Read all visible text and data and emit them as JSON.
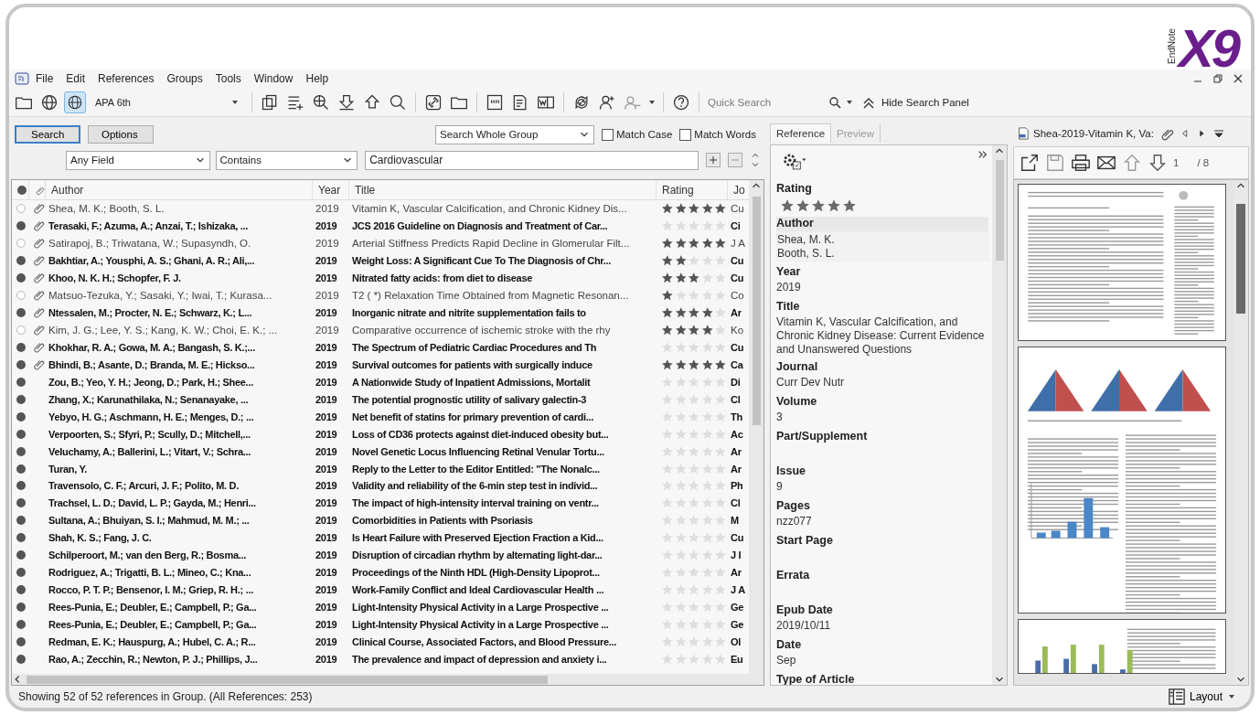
{
  "logo": {
    "product": "EndNote",
    "version": "X9"
  },
  "menu": [
    "File",
    "Edit",
    "References",
    "Groups",
    "Tools",
    "Window",
    "Help"
  ],
  "toolbar": {
    "style": "APA 6th",
    "quick_search": {
      "placeholder": "Quick Search"
    },
    "hide_search_panel": "Hide Search Panel"
  },
  "search_panel": {
    "search_button": "Search",
    "options_button": "Options",
    "scope": "Search Whole Group",
    "match_case": {
      "label": "Match Case",
      "checked": false
    },
    "match_words": {
      "label": "Match Words",
      "checked": false
    },
    "criteria": [
      {
        "field": "Any Field",
        "operator": "Contains",
        "value": "Cardiovascular"
      }
    ]
  },
  "table": {
    "columns": [
      "Author",
      "Year",
      "Title",
      "Rating",
      "Jo"
    ],
    "rows": [
      {
        "read": true,
        "attachment": true,
        "author": "Shea, M. K.; Booth, S. L.",
        "year": "2019",
        "title": "Vitamin K, Vascular Calcification, and Chronic Kidney Dis...",
        "stars": 5,
        "journal": "Cu"
      },
      {
        "read": false,
        "attachment": true,
        "author": "Terasaki, F.; Azuma, A.; Anzai, T.; Ishizaka, ...",
        "year": "2019",
        "title": "JCS 2016 Guideline on Diagnosis and Treatment of Car...",
        "stars": 0,
        "journal": "Ci"
      },
      {
        "read": true,
        "attachment": true,
        "author": "Satirapoj, B.; Triwatana, W.; Supasyndh, O.",
        "year": "2019",
        "title": "Arterial Stiffness Predicts Rapid Decline in Glomerular Filt...",
        "stars": 5,
        "journal": "J A"
      },
      {
        "read": false,
        "attachment": true,
        "author": "Bakhtiar, A.; Yousphi, A. S.; Ghani, A. R.; Ali,...",
        "year": "2019",
        "title": "Weight Loss: A Significant Cue To The Diagnosis of Chr...",
        "stars": 2,
        "journal": "Cu"
      },
      {
        "read": false,
        "attachment": true,
        "author": "Khoo, N. K. H.; Schopfer, F. J.",
        "year": "2019",
        "title": "Nitrated fatty acids: from diet to disease",
        "stars": 3,
        "journal": "Cu"
      },
      {
        "read": true,
        "attachment": true,
        "author": "Matsuo-Tezuka, Y.; Sasaki, Y.; Iwai, T.; Kurasa...",
        "year": "2019",
        "title": "T2 ( *) Relaxation Time Obtained from Magnetic Resonan...",
        "stars": 1,
        "journal": "Co"
      },
      {
        "read": false,
        "attachment": true,
        "author": "Ntessalen, M.; Procter, N. E.; Schwarz, K.; L...",
        "year": "2019",
        "title": "Inorganic nitrate and nitrite supplementation fails to",
        "stars": 4,
        "journal": "Ar"
      },
      {
        "read": true,
        "attachment": true,
        "author": "Kim, J. G.; Lee, Y. S.; Kang, K. W.; Choi, E. K.; ...",
        "year": "2019",
        "title": "Comparative occurrence of ischemic stroke with the rhy",
        "stars": 4,
        "journal": "Ko"
      },
      {
        "read": false,
        "attachment": true,
        "author": "Khokhar, R. A.; Gowa, M. A.; Bangash, S. K.;...",
        "year": "2019",
        "title": "The Spectrum of Pediatric Cardiac Procedures and Th",
        "stars": 0,
        "journal": "Cu"
      },
      {
        "read": false,
        "attachment": true,
        "author": "Bhindi, B.; Asante, D.; Branda, M. E.; Hickso...",
        "year": "2019",
        "title": "Survival outcomes for patients with surgically induce",
        "stars": 5,
        "journal": "Ca"
      },
      {
        "read": false,
        "attachment": false,
        "author": "Zou, B.; Yeo, Y. H.; Jeong, D.; Park, H.; Shee...",
        "year": "2019",
        "title": "A Nationwide Study of Inpatient Admissions, Mortalit",
        "stars": 0,
        "journal": "Di"
      },
      {
        "read": false,
        "attachment": false,
        "author": "Zhang, X.; Karunathilaka, N.; Senanayake, ...",
        "year": "2019",
        "title": "The potential prognostic utility of salivary galectin-3",
        "stars": 0,
        "journal": "Cl"
      },
      {
        "read": false,
        "attachment": false,
        "author": "Yebyo, H. G.; Aschmann, H. E.; Menges, D.; ...",
        "year": "2019",
        "title": "Net benefit of statins for primary prevention of cardi...",
        "stars": 0,
        "journal": "Th"
      },
      {
        "read": false,
        "attachment": false,
        "author": "Verpoorten, S.; Sfyri, P.; Scully, D.; Mitchell,...",
        "year": "2019",
        "title": "Loss of CD36 protects against diet-induced obesity but...",
        "stars": 0,
        "journal": "Ac"
      },
      {
        "read": false,
        "attachment": false,
        "author": "Veluchamy, A.; Ballerini, L.; Vitart, V.; Schra...",
        "year": "2019",
        "title": "Novel Genetic Locus Influencing Retinal Venular Tortu...",
        "stars": 0,
        "journal": "Ar"
      },
      {
        "read": false,
        "attachment": false,
        "author": "Turan, Y.",
        "year": "2019",
        "title": "Reply to the Letter to the Editor Entitled: \"The Nonalc...",
        "stars": 0,
        "journal": "Ar"
      },
      {
        "read": false,
        "attachment": false,
        "author": "Travensolo, C. F.; Arcuri, J. F.; Polito, M. D.",
        "year": "2019",
        "title": "Validity and reliability of the 6-min step test in individ...",
        "stars": 0,
        "journal": "Ph"
      },
      {
        "read": false,
        "attachment": false,
        "author": "Trachsel, L. D.; David, L. P.; Gayda, M.; Henri...",
        "year": "2019",
        "title": "The impact of high-intensity interval training on ventr...",
        "stars": 0,
        "journal": "Cl"
      },
      {
        "read": false,
        "attachment": false,
        "author": "Sultana, A.; Bhuiyan, S. I.; Mahmud, M. M.; ...",
        "year": "2019",
        "title": "Comorbidities in Patients with Psoriasis",
        "stars": 0,
        "journal": "M"
      },
      {
        "read": false,
        "attachment": false,
        "author": "Shah, K. S.; Fang, J. C.",
        "year": "2019",
        "title": "Is Heart Failure with Preserved Ejection Fraction a Kid...",
        "stars": 0,
        "journal": "Cu"
      },
      {
        "read": false,
        "attachment": false,
        "author": "Schilperoort, M.; van den Berg, R.; Bosma...",
        "year": "2019",
        "title": "Disruption of circadian rhythm by alternating light-dar...",
        "stars": 0,
        "journal": "J I"
      },
      {
        "read": false,
        "attachment": false,
        "author": "Rodriguez, A.; Trigatti, B. L.; Mineo, C.; Kna...",
        "year": "2019",
        "title": "Proceedings of the Ninth HDL (High-Density Lipoprot...",
        "stars": 0,
        "journal": "Ar"
      },
      {
        "read": false,
        "attachment": false,
        "author": "Rocco, P. T. P.; Bensenor, I. M.; Griep, R. H.; ...",
        "year": "2019",
        "title": "Work-Family Conflict and Ideal Cardiovascular Health ...",
        "stars": 0,
        "journal": "J A"
      },
      {
        "read": false,
        "attachment": false,
        "author": "Rees-Punia, E.; Deubler, E.; Campbell, P.; Ga...",
        "year": "2019",
        "title": "Light-Intensity Physical Activity in a Large Prospective ...",
        "stars": 0,
        "journal": "Ge"
      },
      {
        "read": false,
        "attachment": false,
        "author": "Rees-Punia, E.; Deubler, E.; Campbell, P.; Ga...",
        "year": "2019",
        "title": "Light-Intensity Physical Activity in a Large Prospective ...",
        "stars": 0,
        "journal": "Ge"
      },
      {
        "read": false,
        "attachment": false,
        "author": "Redman, E. K.; Hauspurg, A.; Hubel, C. A.; R...",
        "year": "2019",
        "title": "Clinical Course, Associated Factors, and Blood Pressure...",
        "stars": 0,
        "journal": "Ol"
      },
      {
        "read": false,
        "attachment": false,
        "author": "Rao, A.; Zecchin, R.; Newton, P. J.; Phillips, J...",
        "year": "2019",
        "title": "The prevalence and impact of depression and anxiety i...",
        "stars": 0,
        "journal": "Eu"
      }
    ]
  },
  "reference_panel": {
    "tabs": [
      {
        "label": "Reference",
        "selected": true
      },
      {
        "label": "Preview",
        "selected": false
      }
    ],
    "fields": [
      {
        "kind": "stars",
        "label": "Rating",
        "stars": 5
      },
      {
        "kind": "list",
        "label": "Author",
        "values": [
          "Shea, M. K.",
          "Booth, S. L."
        ]
      },
      {
        "kind": "text",
        "label": "Year",
        "value": "2019"
      },
      {
        "kind": "text",
        "label": "Title",
        "value": "Vitamin K, Vascular Calcification, and Chronic Kidney Disease: Current Evidence and Unanswered Questions"
      },
      {
        "kind": "text",
        "label": "Journal",
        "value": "Curr Dev Nutr"
      },
      {
        "kind": "text",
        "label": "Volume",
        "value": "3"
      },
      {
        "kind": "text",
        "label": "Part/Supplement"
      },
      {
        "kind": "text",
        "label": "Issue",
        "value": "9"
      },
      {
        "kind": "text",
        "label": "Pages",
        "value": "nzz077"
      },
      {
        "kind": "text",
        "label": "Start Page"
      },
      {
        "kind": "text",
        "label": "Errata"
      },
      {
        "kind": "text",
        "label": "Epub Date",
        "value": "2019/10/11"
      },
      {
        "kind": "text",
        "label": "Date",
        "value": "Sep"
      },
      {
        "kind": "text",
        "label": "Type of Article"
      }
    ]
  },
  "pdf_viewer": {
    "tab": "Shea-2019-Vitamin K, Va:",
    "page": "1",
    "page_count": "/ 8"
  },
  "status_bar": {
    "text": "Showing 52 of 52 references in Group. (All References: 253)",
    "layout_button": "Layout"
  }
}
